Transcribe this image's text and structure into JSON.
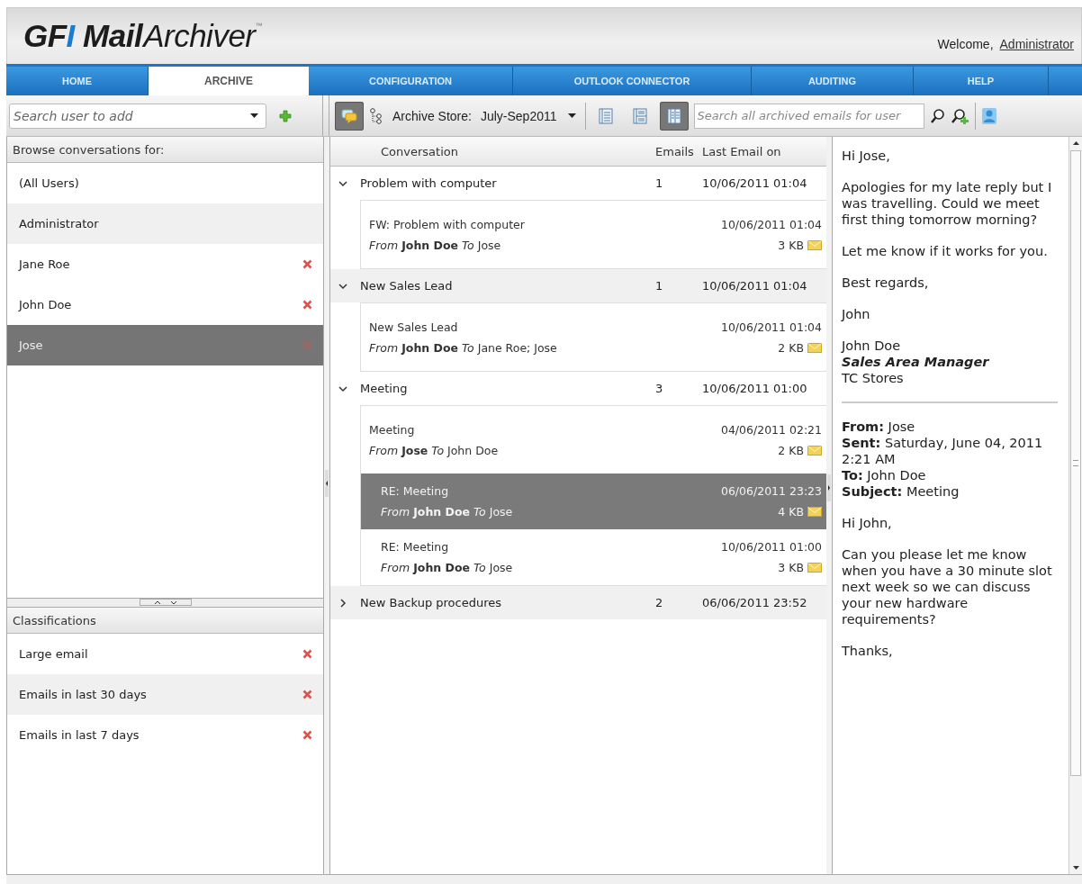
{
  "header": {
    "logo": {
      "brand": "GF",
      "brand_accent": "I",
      "product_bold": "Mail",
      "product": "Archiver",
      "tm": "™"
    },
    "welcome": "Welcome,",
    "user_link": "Administrator"
  },
  "tabs": [
    {
      "label": "HOME",
      "selected": false
    },
    {
      "label": "ARCHIVE",
      "selected": true
    },
    {
      "label": "CONFIGURATION",
      "selected": false
    },
    {
      "label": "OUTLOOK CONNECTOR",
      "selected": false
    },
    {
      "label": "AUDITING",
      "selected": false
    },
    {
      "label": "HELP",
      "selected": false
    }
  ],
  "user_search": {
    "placeholder": "Search user to add"
  },
  "toolbar": {
    "conversation_view_selected": true,
    "store_label": "Archive Store:",
    "store_value": "July-Sep2011",
    "layout_buttons": [
      {
        "selected": false
      },
      {
        "selected": false
      },
      {
        "selected": true
      }
    ],
    "search_placeholder": "Search all archived emails for user"
  },
  "users": {
    "title": "Browse conversations for:",
    "items": [
      {
        "name": "(All Users)",
        "removable": false,
        "selected": false
      },
      {
        "name": "Administrator",
        "removable": false,
        "selected": false
      },
      {
        "name": "Jane Roe",
        "removable": true,
        "selected": false
      },
      {
        "name": "John Doe",
        "removable": true,
        "selected": false
      },
      {
        "name": "Jose",
        "removable": true,
        "selected": true
      }
    ]
  },
  "classifications": {
    "title": "Classifications",
    "items": [
      {
        "name": "Large email",
        "removable": true
      },
      {
        "name": "Emails in last 30 days",
        "removable": true
      },
      {
        "name": "Emails in last 7 days",
        "removable": true
      }
    ]
  },
  "conversations": {
    "columns": [
      "Conversation",
      "Emails",
      "Last Email on"
    ],
    "rows": [
      {
        "subject": "Problem with computer",
        "count": "1",
        "last": "10/06/2011 01:04",
        "expanded": true,
        "emails": [
          {
            "subject": "FW: Problem with computer",
            "date": "10/06/2011 01:04",
            "from_to": "*From* **John Doe** *To* Jose",
            "size": "3 KB",
            "selected": false,
            "indented": false
          }
        ]
      },
      {
        "subject": "New Sales Lead",
        "count": "1",
        "last": "10/06/2011 01:04",
        "expanded": true,
        "emails": [
          {
            "subject": "New Sales Lead",
            "date": "10/06/2011 01:04",
            "from_to": "*From* **John Doe** *To* Jane Roe; Jose",
            "size": "2 KB",
            "selected": false,
            "indented": false
          }
        ]
      },
      {
        "subject": "Meeting",
        "count": "3",
        "last": "10/06/2011 01:00",
        "expanded": true,
        "emails": [
          {
            "subject": "Meeting",
            "date": "04/06/2011 02:21",
            "from_to": "*From* **Jose** *To* John Doe",
            "size": "2 KB",
            "selected": false,
            "indented": false
          },
          {
            "subject": "RE: Meeting",
            "date": "06/06/2011 23:23",
            "from_to": "*From* **John Doe** *To* Jose",
            "size": "4 KB",
            "selected": true,
            "indented": true
          },
          {
            "subject": "RE: Meeting",
            "date": "10/06/2011 01:00",
            "from_to": "*From* **John Doe** *To* Jose",
            "size": "3 KB",
            "selected": false,
            "indented": true
          }
        ]
      },
      {
        "subject": "New Backup procedures",
        "count": "2",
        "last": "06/06/2011 23:52",
        "expanded": false,
        "emails": []
      }
    ]
  },
  "preview": {
    "paragraphs": [
      {
        "kind": "text",
        "lines": [
          "Hi Jose,"
        ]
      },
      {
        "kind": "text",
        "lines": [
          "Apologies for my late reply but I was travelling. Could we meet first thing tomorrow morning?"
        ]
      },
      {
        "kind": "text",
        "lines": [
          "Let me know if it works for you."
        ]
      },
      {
        "kind": "text",
        "lines": [
          "Best regards,"
        ]
      },
      {
        "kind": "text",
        "lines": [
          "John"
        ]
      },
      {
        "kind": "signature",
        "lines": [
          "John Doe",
          "Sales Area Manager",
          "TC Stores"
        ]
      },
      {
        "kind": "rule"
      },
      {
        "kind": "text",
        "lines": [
          "**From:** Jose",
          "**Sent:** Saturday, June 04, 2011 2:21 AM",
          "**To:** John Doe",
          "**Subject:** Meeting"
        ]
      },
      {
        "kind": "text",
        "lines": [
          "Hi John,"
        ]
      },
      {
        "kind": "text",
        "lines": [
          "Can you please let me know when you have a 30 minute slot next week so we can discuss your new hardware requirements?"
        ]
      },
      {
        "kind": "text",
        "lines": [
          "Thanks,"
        ]
      }
    ]
  }
}
